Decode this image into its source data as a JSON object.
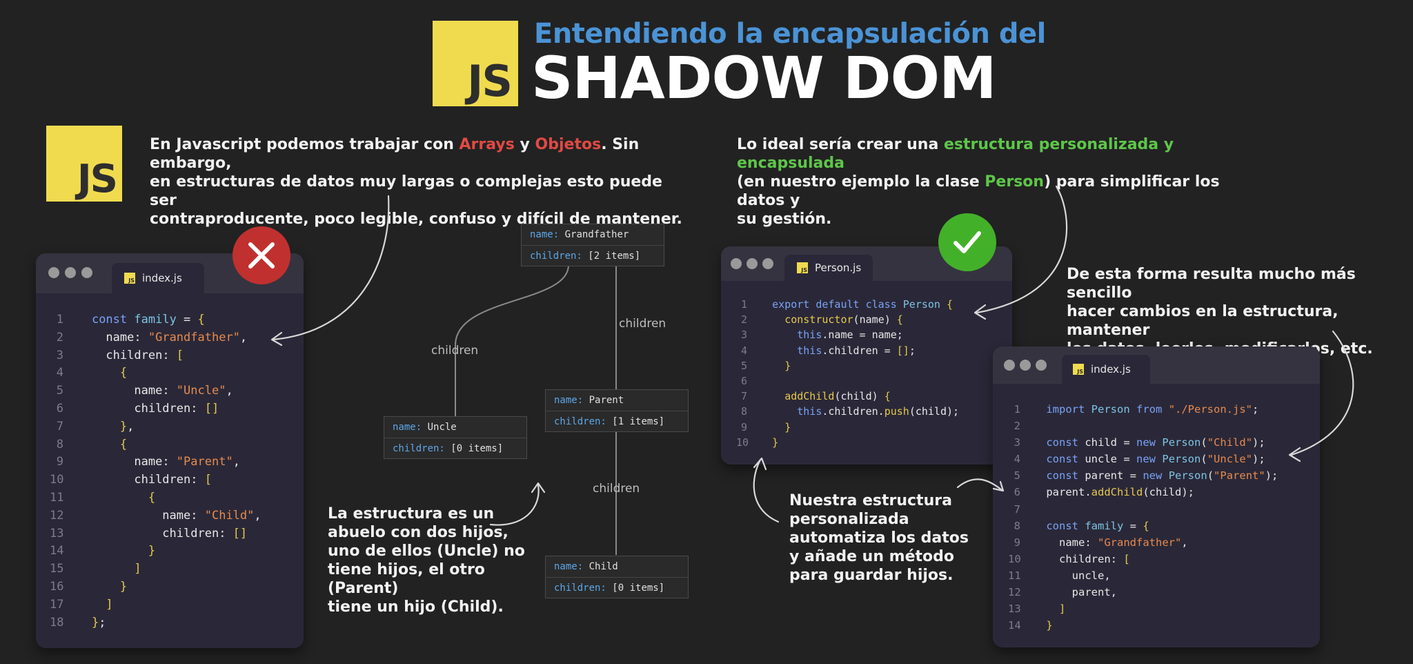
{
  "header": {
    "logo": "JS",
    "subtitle": "Entendiendo la encapsulación del",
    "title": "SHADOW DOM"
  },
  "left_logo": "JS",
  "intro_left": {
    "t1": "En Javascript podemos trabajar con ",
    "arrays": "Arrays",
    "t2": " y ",
    "objetos": "Objetos",
    "t3": ". Sin embargo,",
    "line2": "en estructuras de datos muy largas o complejas esto puede ser",
    "line3": "contraproducente, poco legible, confuso y difícil de mantener."
  },
  "intro_right": {
    "t1": "Lo ideal sería crear una ",
    "highlight": "estructura personalizada y encapsulada",
    "t2": "(en nuestro ejemplo la clase ",
    "person": "Person",
    "t3": ") para simplificar los datos y",
    "line3": "su gestión."
  },
  "note_right": {
    "line1": "De esta forma resulta mucho más sencillo",
    "line2": "hacer cambios en la estructura, mantener",
    "line3": "los datos, leerlos, modificarlos, etc."
  },
  "note_center": {
    "line1": "La estructura  es un",
    "line2": "abuelo con dos hijos,",
    "line3": "uno de ellos (Uncle) no",
    "line4": "tiene hijos, el otro (Parent)",
    "line5": "tiene un hijo (Child)."
  },
  "note_bottom": {
    "line1": "Nuestra estructura",
    "line2": "personalizada",
    "line3": "automatiza los datos",
    "line4": "y añade un método",
    "line5": "para guardar hijos."
  },
  "windows": {
    "bad": {
      "tab": "index.js",
      "badge": "x-icon",
      "badge_color": "#c0302f"
    },
    "person": {
      "tab": "Person.js",
      "badge": "check-icon",
      "badge_color": "#43b02a"
    },
    "good": {
      "tab": "index.js"
    }
  },
  "diagram": {
    "key_name": "name:",
    "key_children": "children:",
    "nodes": [
      {
        "name": "Grandfather",
        "children": "[2 items]"
      },
      {
        "name": "Uncle",
        "children": "[0 items]"
      },
      {
        "name": "Parent",
        "children": "[1 items]"
      },
      {
        "name": "Child",
        "children": "[0 items]"
      }
    ],
    "edge_label": "children"
  }
}
